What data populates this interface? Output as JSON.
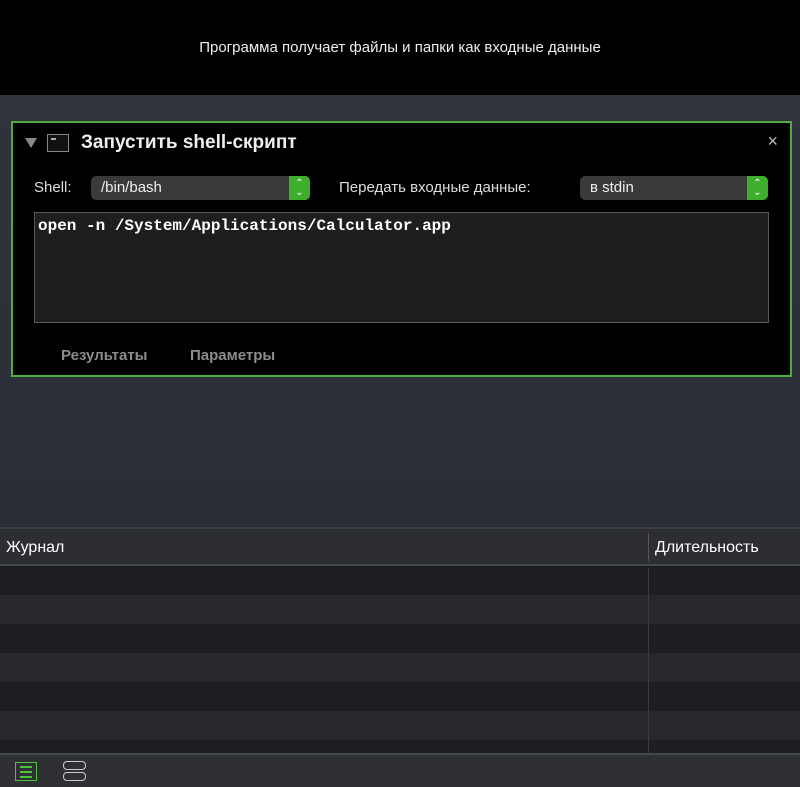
{
  "header": {
    "message": "Программа получает файлы и папки как входные данные"
  },
  "action": {
    "title": "Запустить shell-скрипт",
    "close": "×",
    "shell_label": "Shell:",
    "shell_value": "/bin/bash",
    "input_label": "Передать входные данные:",
    "input_value": "в stdin",
    "script": "open -n /System/Applications/Calculator.app",
    "tabs": [
      "Результаты",
      "Параметры"
    ]
  },
  "log": {
    "columns": [
      "Журнал",
      "Длительность"
    ]
  },
  "colors": {
    "accent": "#4fae3a"
  }
}
